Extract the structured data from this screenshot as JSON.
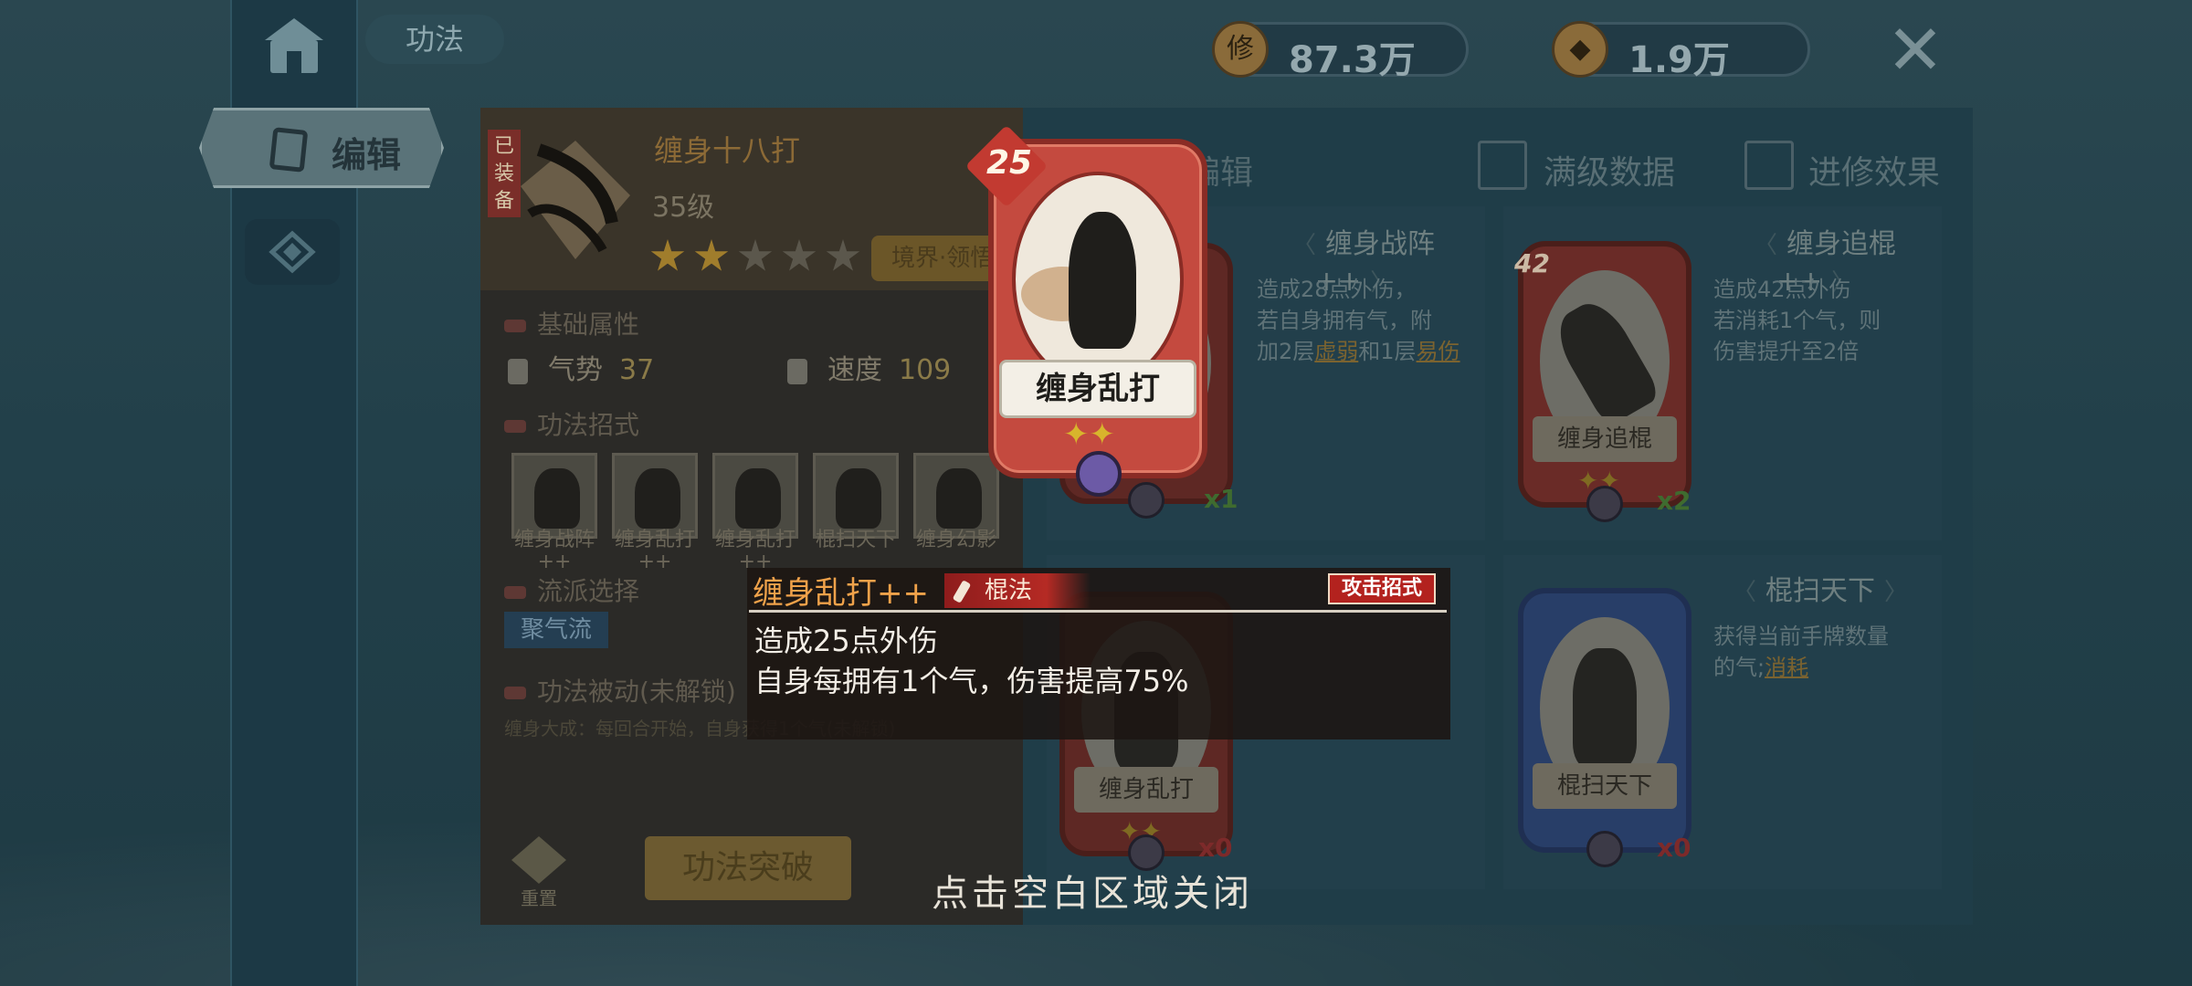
{
  "header": {
    "title": "功法",
    "currency1": {
      "icon": "修",
      "value": "87.3万"
    },
    "currency2": {
      "value": "1.9万"
    },
    "close_label": "✕"
  },
  "left_nav": {
    "edit_tab": "编辑"
  },
  "equipped": {
    "tag": "已装备",
    "name": "缠身十八打",
    "level": "35级",
    "stars_total": 5,
    "stars_filled": 2,
    "realm_button": "境界·领悟"
  },
  "sections": {
    "base_attr": "基础属性",
    "moves": "功法招式",
    "school": "流派选择",
    "passive": "功法被动(未解锁)"
  },
  "stats": {
    "qishi_label": "气势",
    "qishi_value": "37",
    "speed_label": "速度",
    "speed_value": "109"
  },
  "moves": [
    {
      "name": "缠身战阵",
      "plus": "++"
    },
    {
      "name": "缠身乱打",
      "plus": "++"
    },
    {
      "name": "缠身乱打",
      "plus": "++"
    },
    {
      "name": "棍扫天下",
      "plus": ""
    },
    {
      "name": "缠身幻影",
      "plus": ""
    }
  ],
  "school_chip": "聚气流",
  "passive_text": "缠身大成：每回合开始，自身获得1个气(未解锁)",
  "reset_label": "重置",
  "break_button": "功法突破",
  "right_panel": {
    "title": "编辑",
    "chk1": "满级数据",
    "chk2": "进修效果"
  },
  "cards": [
    {
      "head": "缠身战阵++",
      "desc1": "造成28点外伤，",
      "desc2": "若自身拥有气，附",
      "desc3": "加2层",
      "hl1": "虚弱",
      "desc4": "和1层",
      "hl2": "易伤",
      "count": "x1"
    },
    {
      "head": "缠身追棍++",
      "level": "42",
      "name": "缠身追棍",
      "desc1": "造成42点外伤",
      "desc2": "若消耗1个气，则",
      "desc3": "伤害提升至2倍",
      "count": "x2"
    },
    {
      "name": "缠身乱打",
      "count": "x0"
    },
    {
      "head": "棍扫天下",
      "name": "棍扫天下",
      "desc1": "获得当前手牌数量",
      "desc2": "的气;",
      "hl1": "消耗",
      "count": "x0"
    }
  ],
  "popup_card": {
    "level": "25",
    "name": "缠身乱打",
    "plus": "✦✦"
  },
  "tooltip": {
    "title": "缠身乱打++",
    "type": "棍法",
    "tag": "攻击招式",
    "line1": "造成25点外伤",
    "line2": "自身每拥有1个气，伤害提高75%"
  },
  "close_hint": "点击空白区域关闭"
}
